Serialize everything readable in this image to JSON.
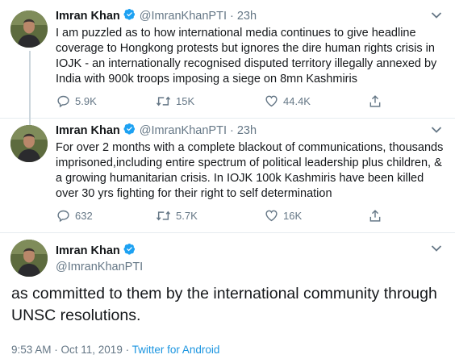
{
  "tweets": [
    {
      "name": "Imran Khan",
      "handle": "@ImranKhanPTI",
      "separator": "·",
      "time": "23h",
      "text": "I am puzzled as to how international  media continues to give headline coverage to Hongkong protests but ignores the dire human rights crisis in IOJK - an internationally recognised disputed territory illegally annexed by India with 900k troops imposing a siege on 8mn Kashmiris",
      "replies": "5.9K",
      "retweets": "15K",
      "likes": "44.4K"
    },
    {
      "name": "Imran Khan",
      "handle": "@ImranKhanPTI",
      "separator": "·",
      "time": "23h",
      "text": "For over 2 months with a complete blackout of communications, thousands imprisoned,including entire spectrum of political leadership plus children, & a growing humanitarian crisis. In IOJK 100k Kashmiris have been killed over 30 yrs fighting for their right to self determination",
      "replies": "632",
      "retweets": "5.7K",
      "likes": "16K"
    }
  ],
  "main_tweet": {
    "name": "Imran Khan",
    "handle": "@ImranKhanPTI",
    "text": "as committed to them by the international community through UNSC resolutions.",
    "timestamp": "9:53 AM · Oct 11, 2019 · ",
    "source": "Twitter for Android"
  },
  "colors": {
    "verified": "#1da1f2",
    "secondary_text": "#657786",
    "link": "#1b95e0",
    "thread_line": "#ccd6dd"
  },
  "icons": [
    "reply-icon",
    "retweet-icon",
    "like-icon",
    "share-icon",
    "verified-badge-icon",
    "caret-down-icon"
  ]
}
